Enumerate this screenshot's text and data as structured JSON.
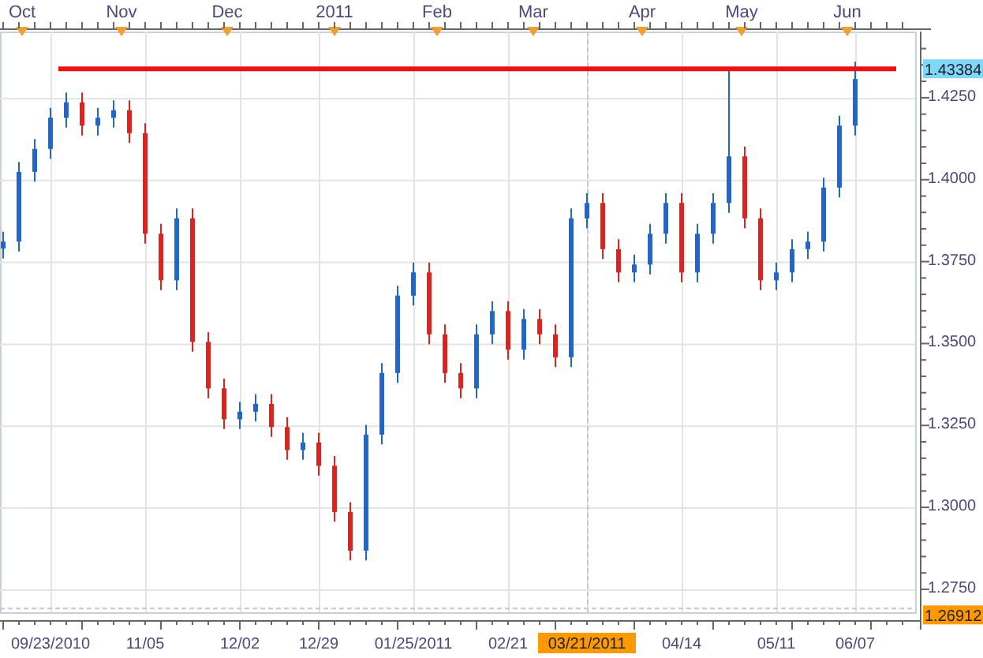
{
  "chart": {
    "top_axis": [
      {
        "label": "Oct"
      },
      {
        "label": "Nov"
      },
      {
        "label": "Dec"
      },
      {
        "label": "2011"
      },
      {
        "label": "Feb"
      },
      {
        "label": "Mar"
      },
      {
        "label": "Apr"
      },
      {
        "label": "May"
      },
      {
        "label": "Jun"
      }
    ],
    "chart_data": {
      "type": "candlestick",
      "grid": true,
      "ylim": [
        1.268,
        1.4452
      ],
      "categories": [
        null,
        null,
        null,
        "09/23/2010",
        null,
        null,
        null,
        null,
        null,
        "11/05",
        null,
        null,
        null,
        null,
        null,
        "12/02",
        null,
        null,
        null,
        null,
        "12/29",
        null,
        null,
        null,
        null,
        null,
        "01/25/2011",
        null,
        null,
        null,
        null,
        null,
        "02/21",
        null,
        null,
        null,
        null,
        "03/21/2011",
        null,
        null,
        null,
        null,
        null,
        "04/14",
        null,
        null,
        null,
        null,
        null,
        "05/11",
        null,
        null,
        null,
        null,
        "06/07"
      ],
      "ohlc": [
        [
          1.379,
          1.3841,
          1.376,
          1.3811
        ],
        [
          1.3811,
          1.4054,
          1.3781,
          1.4024
        ],
        [
          1.4024,
          1.4124,
          1.3994,
          1.4094
        ],
        [
          1.4094,
          1.4219,
          1.4064,
          1.4189
        ],
        [
          1.4189,
          1.4266,
          1.4159,
          1.4236
        ],
        [
          1.4236,
          1.4266,
          1.4135,
          1.4165
        ],
        [
          1.4165,
          1.4219,
          1.4135,
          1.4189
        ],
        [
          1.4189,
          1.4242,
          1.4159,
          1.4212
        ],
        [
          1.4212,
          1.4242,
          1.4112,
          1.4142
        ],
        [
          1.4142,
          1.4172,
          1.3805,
          1.3835
        ],
        [
          1.3835,
          1.3865,
          1.3663,
          1.3693
        ],
        [
          1.3693,
          1.3912,
          1.3663,
          1.3882
        ],
        [
          1.3882,
          1.3912,
          1.3475,
          1.3505
        ],
        [
          1.3505,
          1.3535,
          1.3333,
          1.3363
        ],
        [
          1.3363,
          1.3393,
          1.3239,
          1.3269
        ],
        [
          1.3269,
          1.3322,
          1.3239,
          1.3292
        ],
        [
          1.3292,
          1.3346,
          1.3262,
          1.3316
        ],
        [
          1.3316,
          1.3346,
          1.3215,
          1.3245
        ],
        [
          1.3245,
          1.3275,
          1.3145,
          1.3175
        ],
        [
          1.3175,
          1.3228,
          1.3145,
          1.3198
        ],
        [
          1.3198,
          1.3228,
          1.3097,
          1.3127
        ],
        [
          1.3127,
          1.3157,
          1.2956,
          1.2986
        ],
        [
          1.2986,
          1.3016,
          1.2838,
          1.2868
        ],
        [
          1.2868,
          1.3252,
          1.2838,
          1.3222
        ],
        [
          1.3222,
          1.344,
          1.3192,
          1.341
        ],
        [
          1.341,
          1.3676,
          1.338,
          1.3646
        ],
        [
          1.3646,
          1.3747,
          1.3616,
          1.3717
        ],
        [
          1.3717,
          1.3747,
          1.3498,
          1.3528
        ],
        [
          1.3528,
          1.3558,
          1.338,
          1.341
        ],
        [
          1.341,
          1.344,
          1.3333,
          1.3363
        ],
        [
          1.3363,
          1.3558,
          1.3333,
          1.3528
        ],
        [
          1.3528,
          1.3629,
          1.3498,
          1.3599
        ],
        [
          1.3599,
          1.3629,
          1.3451,
          1.3481
        ],
        [
          1.3481,
          1.3605,
          1.3451,
          1.3575
        ],
        [
          1.3575,
          1.3605,
          1.3498,
          1.3528
        ],
        [
          1.3528,
          1.3558,
          1.3428,
          1.3458
        ],
        [
          1.3458,
          1.3912,
          1.3428,
          1.3882
        ],
        [
          1.3882,
          1.3959,
          1.3852,
          1.3929
        ],
        [
          1.3929,
          1.3959,
          1.3758,
          1.3788
        ],
        [
          1.3788,
          1.3818,
          1.3687,
          1.3717
        ],
        [
          1.3717,
          1.3771,
          1.3687,
          1.3741
        ],
        [
          1.3741,
          1.3865,
          1.3711,
          1.3835
        ],
        [
          1.3835,
          1.3959,
          1.3805,
          1.3929
        ],
        [
          1.3929,
          1.3959,
          1.3687,
          1.3717
        ],
        [
          1.3717,
          1.3865,
          1.3687,
          1.3835
        ],
        [
          1.3835,
          1.3959,
          1.3805,
          1.3929
        ],
        [
          1.3929,
          1.4338,
          1.3899,
          1.4071
        ],
        [
          1.4071,
          1.4101,
          1.3852,
          1.3882
        ],
        [
          1.3882,
          1.3912,
          1.3663,
          1.3693
        ],
        [
          1.3693,
          1.3747,
          1.3663,
          1.3717
        ],
        [
          1.3717,
          1.3818,
          1.3687,
          1.3788
        ],
        [
          1.3788,
          1.3841,
          1.3758,
          1.3811
        ],
        [
          1.3811,
          1.4006,
          1.3781,
          1.3976
        ],
        [
          1.3976,
          1.4195,
          1.3946,
          1.4165
        ],
        [
          1.4165,
          1.436,
          1.4135,
          1.4307
        ]
      ],
      "yticks": [
        {
          "value": 1.425,
          "label": "1.4250"
        },
        {
          "value": 1.4,
          "label": "1.4000"
        },
        {
          "value": 1.375,
          "label": "1.3750"
        },
        {
          "value": 1.35,
          "label": "1.3500"
        },
        {
          "value": 1.325,
          "label": "1.3250"
        },
        {
          "value": 1.3,
          "label": "1.3000"
        },
        {
          "value": 1.275,
          "label": "1.2750"
        }
      ],
      "ref_lines": [
        {
          "axis": "y",
          "value": 1.43384,
          "label": "1.43384",
          "color": "#ee1111"
        },
        {
          "axis": "y",
          "value": 1.26912,
          "label": "1.26912",
          "color": "#c8c8c8"
        },
        {
          "axis": "x",
          "value": "03/21/2011",
          "color": "#c8c8c8"
        }
      ]
    }
  }
}
